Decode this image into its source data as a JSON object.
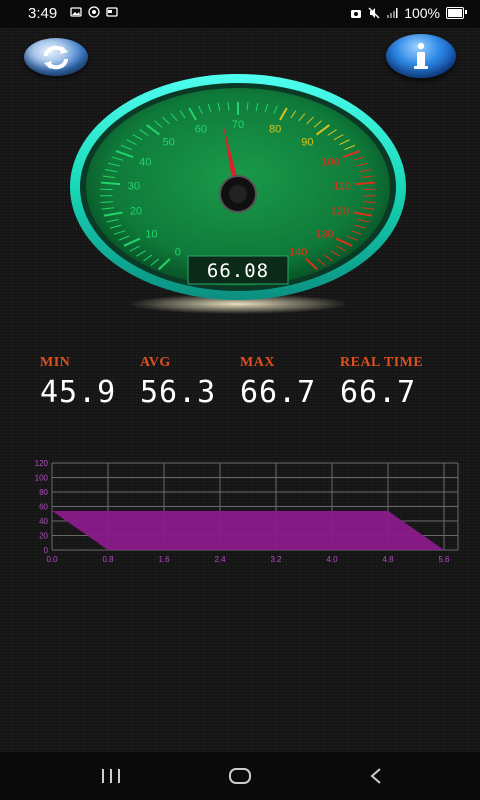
{
  "status_bar": {
    "time": "3:49",
    "battery": "100%",
    "left_icons": [
      "image-icon",
      "eye-icon",
      "card-icon"
    ],
    "right_icons": [
      "camera-icon",
      "mute-icon",
      "signal-icon"
    ]
  },
  "buttons": {
    "refresh": "refresh-icon",
    "info": "info-icon"
  },
  "gauge": {
    "readout": "66.08",
    "needle_value": 66.08,
    "min": 0,
    "max": 140,
    "ticks": [
      "0",
      "10",
      "20",
      "30",
      "40",
      "50",
      "60",
      "70",
      "80",
      "90",
      "100",
      "110",
      "120",
      "130",
      "140"
    ],
    "tick_colors": {
      "normal": "#22d66a",
      "warn": "#d8c21f",
      "danger": "#e0301a"
    },
    "ring_color": "#1fe0c0",
    "face_color": "#0f7a3a"
  },
  "stats": {
    "min_label": "MIN",
    "min_value": "45.9",
    "avg_label": "AVG",
    "avg_value": "56.3",
    "max_label": "MAX",
    "max_value": "66.7",
    "real_label": "REAL TIME",
    "real_value": "66.7"
  },
  "chart_data": {
    "type": "area",
    "x": [
      0.0,
      0.7,
      4.8,
      5.6
    ],
    "y": [
      54,
      0,
      54,
      0
    ],
    "series": [
      {
        "values_x": [
          0.0,
          0.8,
          4.7,
          5.5
        ],
        "values_y": [
          54,
          0,
          54,
          0
        ]
      }
    ],
    "polygon_x": [
      0.0,
      4.8,
      5.6,
      0.8
    ],
    "polygon_y": [
      54,
      54,
      0,
      0
    ],
    "xlim": [
      0.0,
      5.8
    ],
    "ylim": [
      0,
      120
    ],
    "xticks": [
      "0.0",
      "0.8",
      "1.6",
      "2.4",
      "3.2",
      "4.0",
      "4.8",
      "5.6"
    ],
    "yticks": [
      "0",
      "20",
      "40",
      "60",
      "80",
      "100",
      "120"
    ],
    "grid": true,
    "fill_color": "#8a1a8a",
    "tick_color": "#b04ec0"
  },
  "nav": {
    "recents": "recents-icon",
    "home": "home-icon",
    "back": "back-icon"
  }
}
